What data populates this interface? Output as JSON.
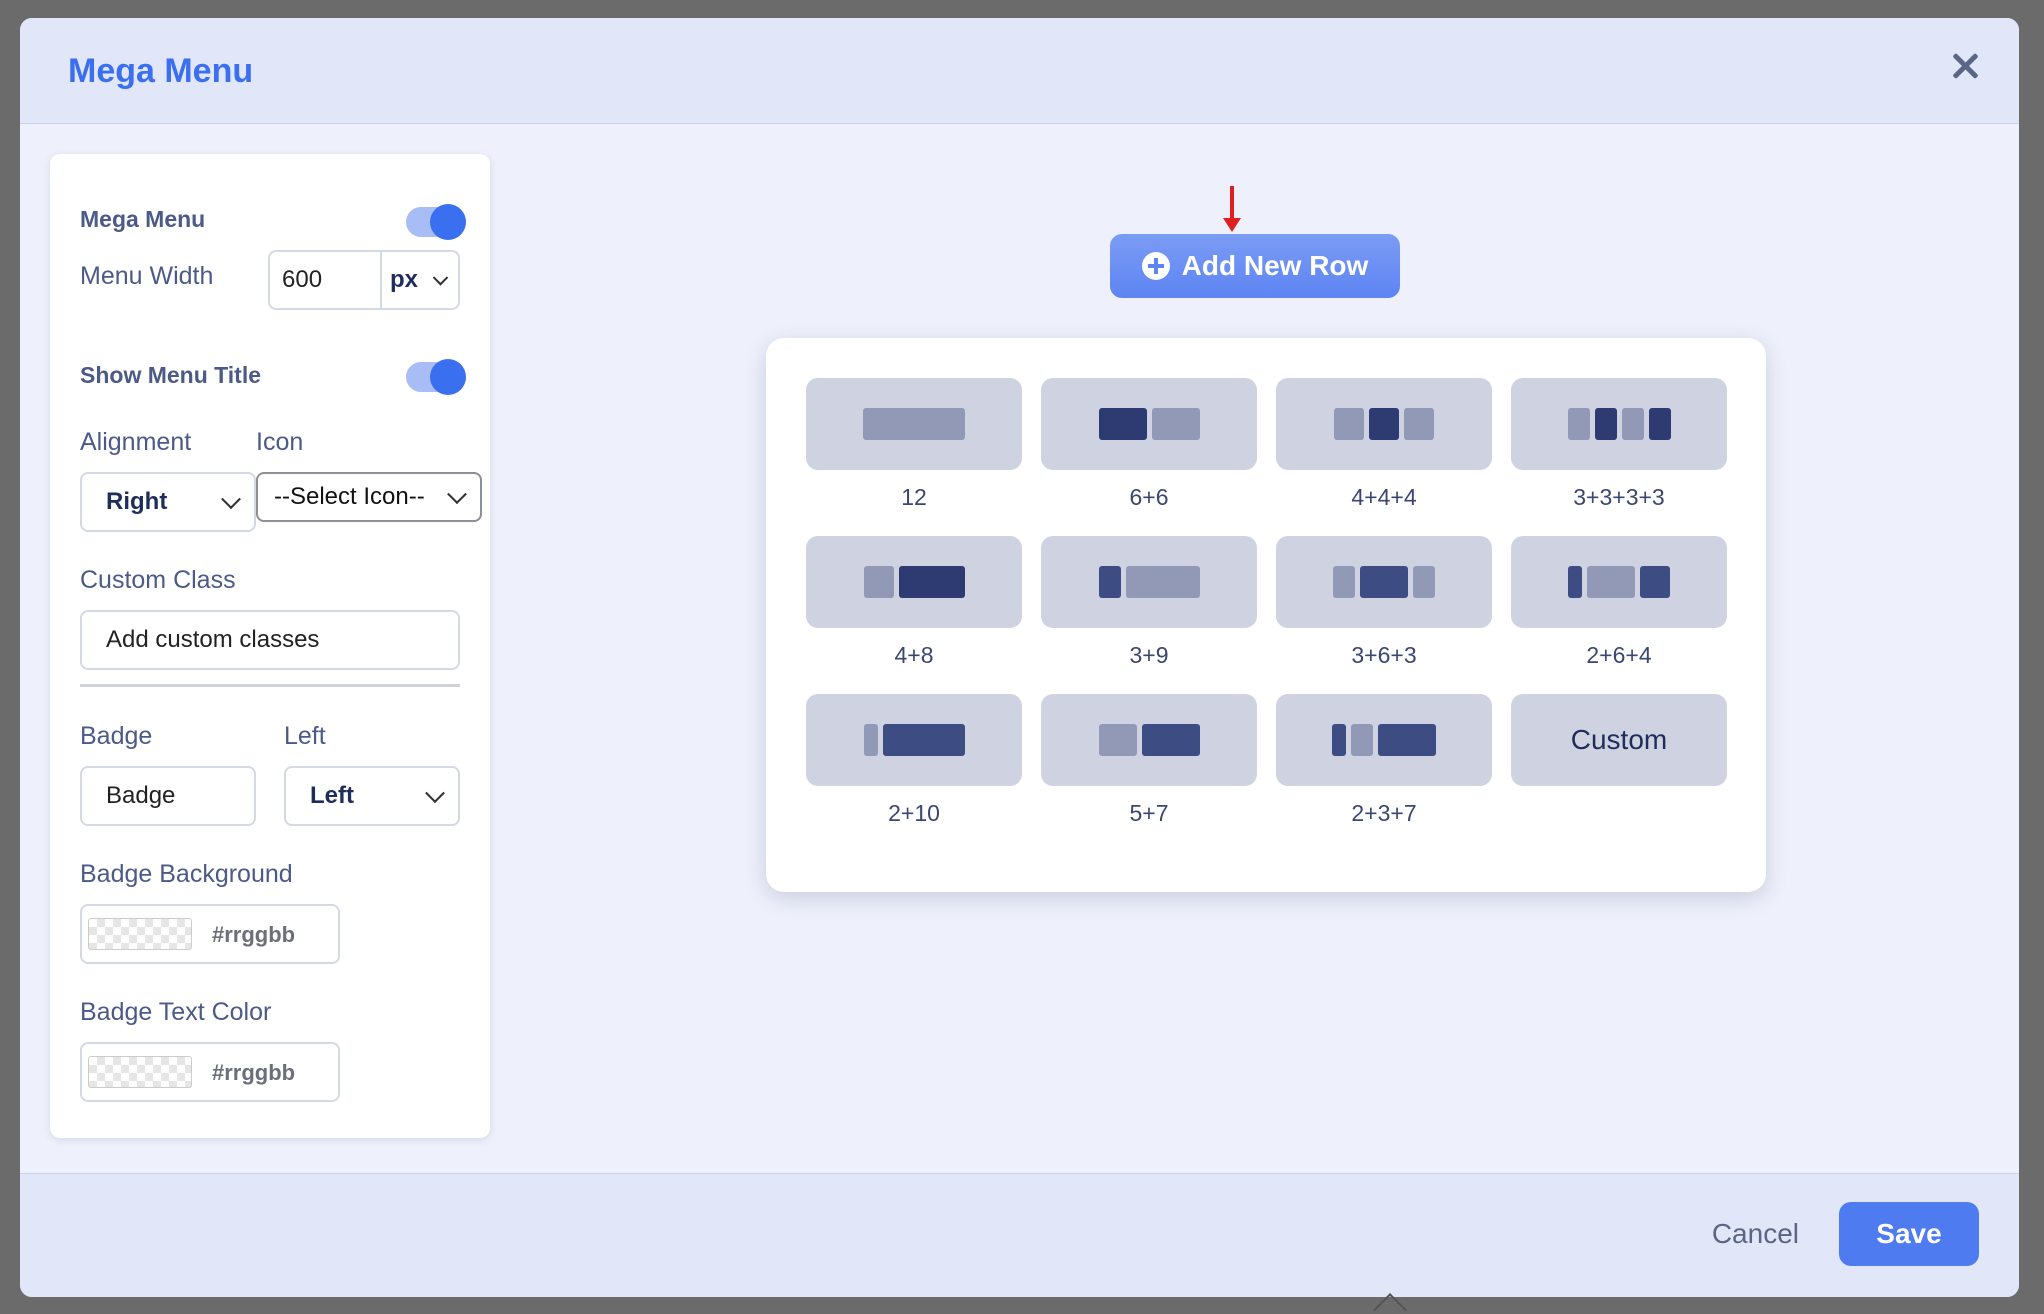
{
  "modal": {
    "title": "Mega Menu",
    "close_icon": "close-icon"
  },
  "panel": {
    "mega_menu_label": "Mega Menu",
    "mega_menu_enabled": true,
    "menu_width_label": "Menu Width",
    "menu_width_value": "600",
    "menu_width_unit": "px",
    "show_title_label": "Show Menu Title",
    "show_title_enabled": true,
    "alignment_label": "Alignment",
    "alignment_value": "Right",
    "icon_label": "Icon",
    "icon_value": "--Select Icon--",
    "custom_class_label": "Custom Class",
    "custom_class_placeholder": "Add custom classes",
    "badge_label": "Badge",
    "badge_placeholder": "Badge",
    "badge_position_label": "Left",
    "badge_position_value": "Left",
    "badge_bg_label": "Badge Background",
    "badge_bg_value": "#rrggbb",
    "badge_text_label": "Badge Text Color",
    "badge_text_value": "#rrggbb"
  },
  "add_row": {
    "label": "Add New Row",
    "icon": "plus-circle-icon"
  },
  "layouts": [
    {
      "caption": "12"
    },
    {
      "caption": "6+6"
    },
    {
      "caption": "4+4+4"
    },
    {
      "caption": "3+3+3+3"
    },
    {
      "caption": "4+8"
    },
    {
      "caption": "3+9"
    },
    {
      "caption": "3+6+3"
    },
    {
      "caption": "2+6+4"
    },
    {
      "caption": "2+10"
    },
    {
      "caption": "5+7"
    },
    {
      "caption": "2+3+7"
    },
    {
      "caption": "Custom"
    }
  ],
  "footer": {
    "cancel_label": "Cancel",
    "save_label": "Save"
  },
  "colors": {
    "accent": "#3a6ff0",
    "header_bg": "#e1e6f8",
    "body_bg": "#eef1fb"
  }
}
